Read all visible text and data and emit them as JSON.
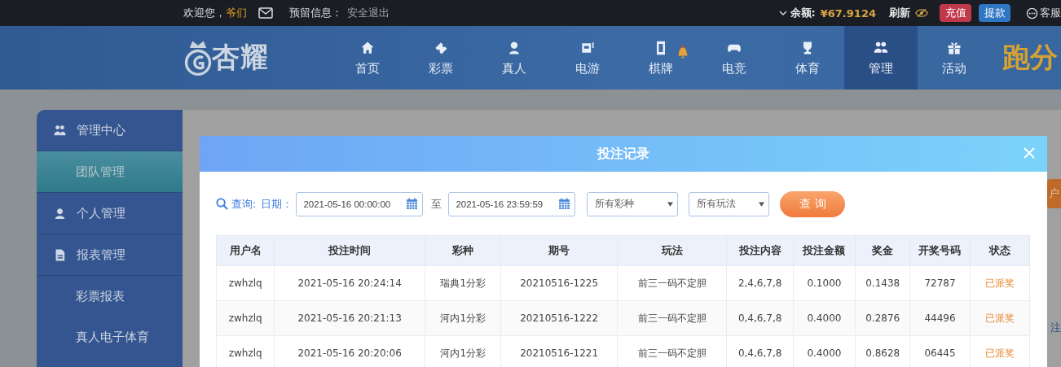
{
  "top_bar": {
    "greeting": "欢迎您，",
    "username": "爷们",
    "reserved_label": "预留信息：",
    "logout": "安全退出",
    "balance_label": "余额:",
    "balance": "¥67.9124",
    "refresh": "刷新",
    "deposit": "充值",
    "withdraw": "提款",
    "service": "客服"
  },
  "nav": {
    "logo": "杏耀",
    "items": [
      {
        "label": "首页",
        "selected": false
      },
      {
        "label": "彩票",
        "selected": false
      },
      {
        "label": "真人",
        "selected": false
      },
      {
        "label": "电游",
        "selected": false
      },
      {
        "label": "棋牌",
        "selected": false
      },
      {
        "label": "电竞",
        "selected": false
      },
      {
        "label": "体育",
        "selected": false
      },
      {
        "label": "管理",
        "selected": true
      },
      {
        "label": "活动",
        "selected": false
      }
    ],
    "promo": "跑分"
  },
  "sidebar": {
    "items": [
      {
        "kind": "group",
        "label": "管理中心",
        "selected": false
      },
      {
        "kind": "sub",
        "label": "团队管理",
        "selected": true
      },
      {
        "kind": "group",
        "label": "个人管理",
        "selected": false
      },
      {
        "kind": "group",
        "label": "报表管理",
        "selected": false
      },
      {
        "kind": "sub",
        "label": "彩票报表",
        "selected": false
      },
      {
        "kind": "sub",
        "label": "真人电子体育",
        "selected": false
      }
    ]
  },
  "page": {
    "side_button": "户",
    "side_link": "注"
  },
  "dialog": {
    "title": "投注记录",
    "filter": {
      "query_label": "查询:",
      "date_label": "日期：",
      "start": "2021-05-16 00:00:00",
      "to": "至",
      "end": "2021-05-16 23:59:59",
      "lottery": "所有彩种",
      "play": "所有玩法",
      "button": "查 询"
    },
    "table": {
      "columns": [
        "用户名",
        "投注时间",
        "彩种",
        "期号",
        "玩法",
        "投注内容",
        "投注金额",
        "奖金",
        "开奖号码",
        "状态"
      ],
      "rows": [
        [
          "zwhzlq",
          "2021-05-16 20:24:14",
          "瑞典1分彩",
          "20210516-1225",
          "前三一码不定胆",
          "2,4,6,7,8",
          "0.1000",
          "0.1438",
          "72787",
          "已派奖"
        ],
        [
          "zwhzlq",
          "2021-05-16 20:21:13",
          "河内1分彩",
          "20210516-1222",
          "前三一码不定胆",
          "0,4,6,7,8",
          "0.4000",
          "0.2876",
          "44496",
          "已派奖"
        ],
        [
          "zwhzlq",
          "2021-05-16 20:20:06",
          "河内1分彩",
          "20210516-1221",
          "前三一码不定胆",
          "0,4,6,7,8",
          "0.4000",
          "0.8628",
          "06445",
          "已派奖"
        ]
      ]
    }
  }
}
